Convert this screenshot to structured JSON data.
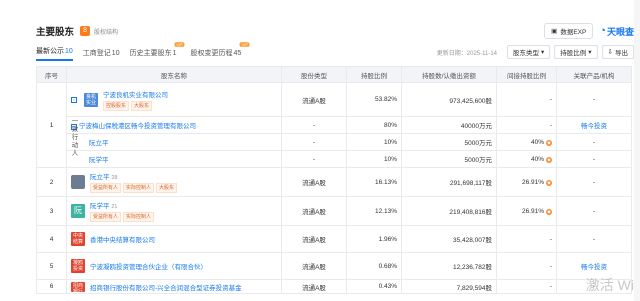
{
  "header": {
    "title": "主要股东",
    "warn_count": "8",
    "equity_label": "股权结构",
    "data_export": "数据EXP",
    "brand": "天眼查"
  },
  "tabs": [
    {
      "label": "最新公示",
      "count": "10"
    },
    {
      "label": "工商登记",
      "count": "10"
    },
    {
      "label": "历史主要股东",
      "count": "1"
    },
    {
      "label": "股权变更历程",
      "count": "45"
    }
  ],
  "toolbar": {
    "updated": "更新日期：2025-11-14",
    "shareholder_type": "股东类型",
    "holding_ratio": "持股比例",
    "export": "导出"
  },
  "table": {
    "headers": [
      "序号",
      "股东名称",
      "股份类型",
      "持股比例",
      "持股数/认缴出资额",
      "间接持股比例",
      "关联产品/机构"
    ],
    "group_label": "一致行动人",
    "rows": [
      {
        "seq": "1",
        "name": "宁波良机实业有限公司",
        "logo": "良机实业",
        "tags": [
          "控股股东",
          "大股东"
        ],
        "type": "流通A股",
        "ratio": "53.82%",
        "shares": "973,425,600股",
        "indirect": "-",
        "related": "-"
      },
      {
        "seq": "",
        "name": "宁波梅山保税港区畅今投资管理有限公司",
        "logo": "",
        "tags": [],
        "type": "-",
        "ratio": "80%",
        "shares": "40000万元",
        "indirect": "-",
        "related": "畅今投资"
      },
      {
        "seq": "",
        "name": "阮立平",
        "logo": "",
        "tags": [],
        "type": "-",
        "ratio": "10%",
        "shares": "5000万元",
        "indirect": "40%",
        "related": "-"
      },
      {
        "seq": "",
        "name": "阮学平",
        "logo": "",
        "tags": [],
        "type": "-",
        "ratio": "10%",
        "shares": "5000万元",
        "indirect": "40%",
        "related": "-"
      },
      {
        "seq": "2",
        "name": "阮立平",
        "logo": "",
        "badge": "28",
        "tags": [
          "受益所有人",
          "实际控制人",
          "大股东"
        ],
        "type": "流通A股",
        "ratio": "16.13%",
        "shares": "291,698,117股",
        "indirect": "26.91%",
        "related": "-"
      },
      {
        "seq": "3",
        "name": "阮学平",
        "logo": "阮",
        "badge": "21",
        "tags": [
          "受益所有人",
          "实际控制人"
        ],
        "type": "流通A股",
        "ratio": "12.13%",
        "shares": "219,408,816股",
        "indirect": "26.91%",
        "related": "-"
      },
      {
        "seq": "4",
        "name": "香港中央结算有限公司",
        "logo": "中央结算",
        "tags": [],
        "type": "流通A股",
        "ratio": "1.96%",
        "shares": "35,428,007股",
        "indirect": "-",
        "related": "-"
      },
      {
        "seq": "5",
        "name": "宁波凝鸥投资管理合伙企业（有限合伙）",
        "logo": "凝鸥投资",
        "tags": [],
        "type": "流通A股",
        "ratio": "0.68%",
        "shares": "12,236,782股",
        "indirect": "-",
        "related": "畅今投资"
      },
      {
        "seq": "6",
        "name": "招商银行股份有限公司-兴全合润混合型证券投资基金",
        "logo": "招商银行",
        "tags": [],
        "type": "流通A股",
        "ratio": "0.43%",
        "shares": "7,829,594股",
        "indirect": "-",
        "related": "-"
      }
    ]
  },
  "watermark": "激活 Wi",
  "colors": {
    "accent": "#1478f0",
    "warn": "#ff7a1a",
    "header_bg": "#f2f4f7"
  }
}
